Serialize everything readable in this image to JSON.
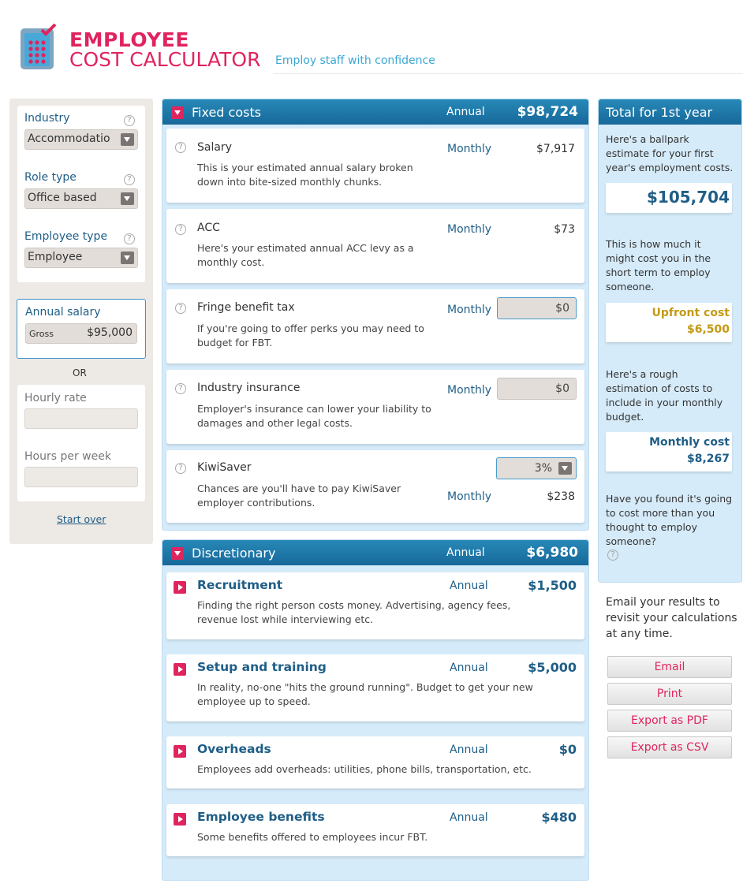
{
  "header": {
    "title_line1": "EMPLOYEE",
    "title_line2": "COST CALCULATOR",
    "tagline": "Employ staff with confidence"
  },
  "sidebar": {
    "industry_label": "Industry",
    "industry_value": "Accommodatio",
    "role_label": "Role type",
    "role_value": "Office based",
    "emptype_label": "Employee type",
    "emptype_value": "Employee",
    "salary_label": "Annual salary",
    "salary_type": "Gross",
    "salary_value": "$95,000",
    "or": "OR",
    "hourly_label": "Hourly rate",
    "hours_label": "Hours per week",
    "start_over": "Start over"
  },
  "fixed": {
    "title": "Fixed costs",
    "period": "Annual",
    "total": "$98,724",
    "items": [
      {
        "title": "Salary",
        "desc1": "This is your estimated annual salary broken",
        "desc2": "down into bite-sized monthly chunks.",
        "freq": "Monthly",
        "value": "$7,917"
      },
      {
        "title": "ACC",
        "desc1": "Here's your estimated annual ACC levy as a",
        "desc2": "monthly cost.",
        "freq": "Monthly",
        "value": "$73"
      },
      {
        "title": "Fringe benefit tax",
        "desc1": "If you're going to offer perks you may need to",
        "desc2": "budget for FBT.",
        "freq": "Monthly",
        "value": "$0"
      },
      {
        "title": "Industry insurance",
        "desc1": "Employer's insurance can lower your liability to",
        "desc2": "damages and other legal costs.",
        "freq": "Monthly",
        "value": "$0"
      },
      {
        "title": "KiwiSaver",
        "desc1": "Chances are you'll have to pay KiwiSaver",
        "desc2": "employer contributions.",
        "freq": "Monthly",
        "value": "$238",
        "rate": "3%"
      }
    ]
  },
  "disc": {
    "title": "Discretionary",
    "period": "Annual",
    "total": "$6,980",
    "items": [
      {
        "title": "Recruitment",
        "freq": "Annual",
        "value": "$1,500",
        "desc1": "Finding the right person costs money. Advertising, agency fees,",
        "desc2": "revenue lost while interviewing etc."
      },
      {
        "title": "Setup and training",
        "freq": "Annual",
        "value": "$5,000",
        "desc1": "In reality, no-one \"hits the ground running\". Budget to get your new",
        "desc2": "employee up to speed."
      },
      {
        "title": "Overheads",
        "freq": "Annual",
        "value": "$0",
        "desc1": "Employees add overheads: utilities, phone bills, transportation, etc.",
        "desc2": ""
      },
      {
        "title": "Employee benefits",
        "freq": "Annual",
        "value": "$480",
        "desc1": "Some benefits offered to employees incur FBT.",
        "desc2": ""
      }
    ]
  },
  "total": {
    "title": "Total for 1st year",
    "intro": [
      "Here's a ballpark",
      "estimate for your first",
      "year's employment costs."
    ],
    "total_value": "$105,704",
    "upfront_text": [
      "This is how much it",
      "might cost you in the",
      "short term to employ",
      "someone."
    ],
    "upfront_label": "Upfront cost",
    "upfront_value": "$6,500",
    "monthly_text": [
      "Here's a rough",
      "estimation of costs to",
      "include in your monthly",
      "budget."
    ],
    "monthly_label": "Monthly cost",
    "monthly_value": "$8,267",
    "question": [
      "Have you found it's going",
      "to cost more than you",
      "thought to employ",
      "someone?"
    ]
  },
  "email_text": [
    "Email your results to",
    "revisit your calculations",
    "at any time."
  ],
  "buttons": {
    "email": "Email",
    "print": "Print",
    "pdf": "Export as PDF",
    "csv": "Export as CSV"
  },
  "colors": {
    "brand": "#e0245e",
    "accent": "#1f5e86",
    "header_blue": "#1f78a8",
    "upfront_gold": "#c39a16"
  }
}
